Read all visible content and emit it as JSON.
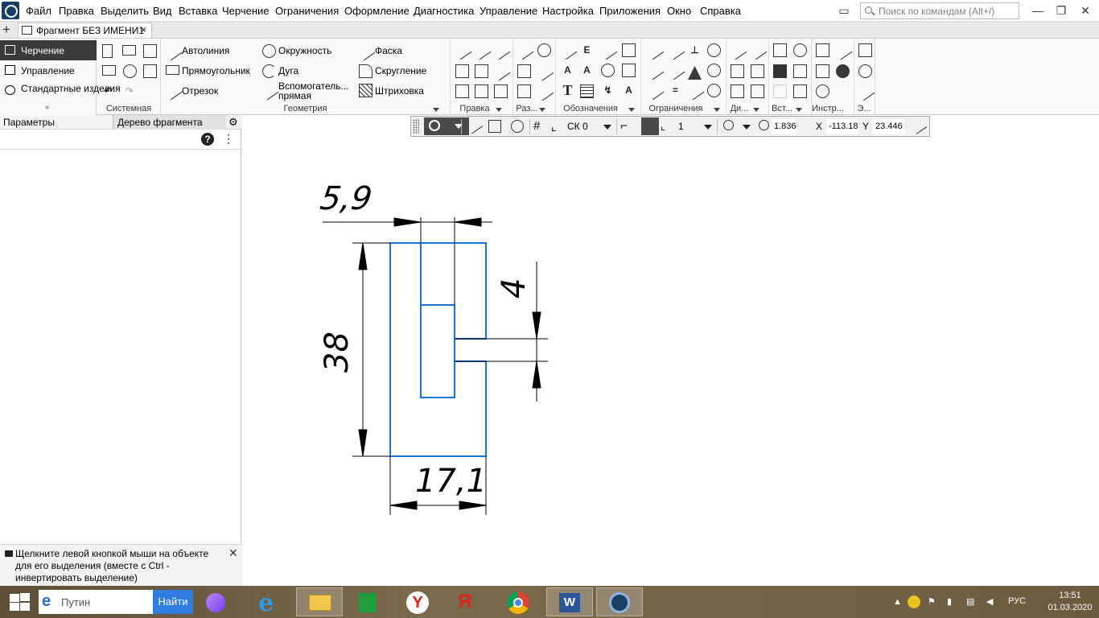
{
  "menubar": {
    "items": [
      "Файл",
      "Правка",
      "Выделить",
      "Вид",
      "Вставка",
      "Черчение",
      "Ограничения",
      "Оформление",
      "Диагностика",
      "Управление",
      "Настройка",
      "Приложения",
      "Окно",
      "Справка"
    ],
    "search_placeholder": "Поиск по командам (Alt+/)"
  },
  "tabs": {
    "document": "Фрагмент БЕЗ ИМЕНИ1",
    "close": "×"
  },
  "ribbon": {
    "modes": [
      "Черчение",
      "Управление",
      "Стандартные изделия"
    ],
    "expand": "»",
    "geometry": {
      "items": [
        "Автолиния",
        "Окружность",
        "Фаска",
        "Прямоугольник",
        "Дуга",
        "Скругление",
        "Отрезок",
        "Вспомогатель... прямая",
        "Штриховка"
      ]
    },
    "group_labels": [
      "Системная",
      "Геометрия",
      "Правка",
      "Раз...",
      "Обозначения",
      "Ограничения",
      "Ди...",
      "Вст...",
      "Инстр...",
      "Э..."
    ]
  },
  "left_panel": {
    "params_tab": "Параметры",
    "tree_tab": "Дерево фрагмента",
    "help": "?",
    "hint": "Щелкните левой кнопкой мыши на объекте для его выделения (вместе с Ctrl - инвертировать выделение)"
  },
  "float_toolbar": {
    "cs": "СК 0",
    "layer": "1",
    "zoom": "1.836",
    "x_label": "X",
    "x_value": "-113.18",
    "y_label": "Y",
    "y_value": "23.446"
  },
  "drawing": {
    "dim_top": "5,9",
    "dim_right": "4",
    "dim_left": "38",
    "dim_bottom": "17,1"
  },
  "taskbar": {
    "search_placeholder": "Путин",
    "search_button": "Найти",
    "lang": "РУС",
    "time": "13:51",
    "date": "01.03.2020"
  },
  "colors": {
    "part_outline": "#1a73d9",
    "dimension": "#000000",
    "mode_active_bg": "#3b3b3b"
  }
}
